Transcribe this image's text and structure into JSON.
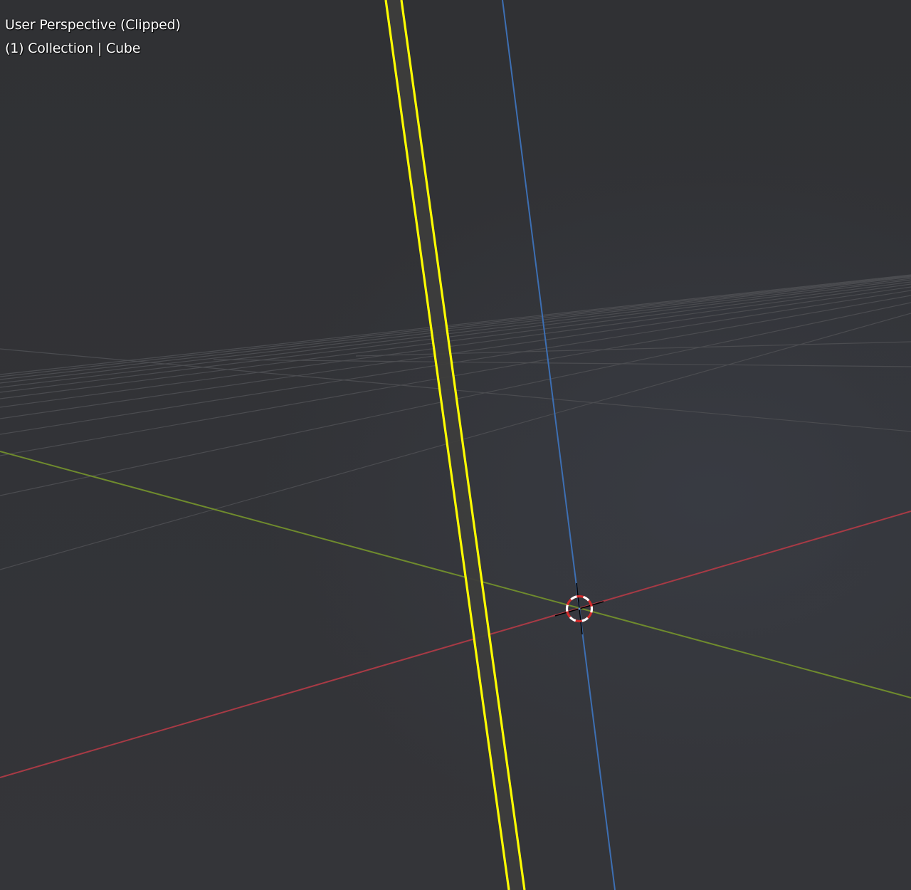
{
  "viewport": {
    "view_name": "User Perspective (Clipped)",
    "frame_and_context": "(1) Collection | Cube"
  },
  "colors": {
    "background": "#2f3033",
    "grid": "#4a4b4f",
    "x_axis": "#a83a45",
    "y_axis": "#6f8b2d",
    "z_axis": "#3d6fb3",
    "selection_outline": "#ffff00",
    "object_face": "#3e3e3e",
    "cursor_red": "#d42a2a",
    "cursor_white": "#ffffff"
  },
  "icons": {
    "cursor": "3d-cursor-icon"
  }
}
